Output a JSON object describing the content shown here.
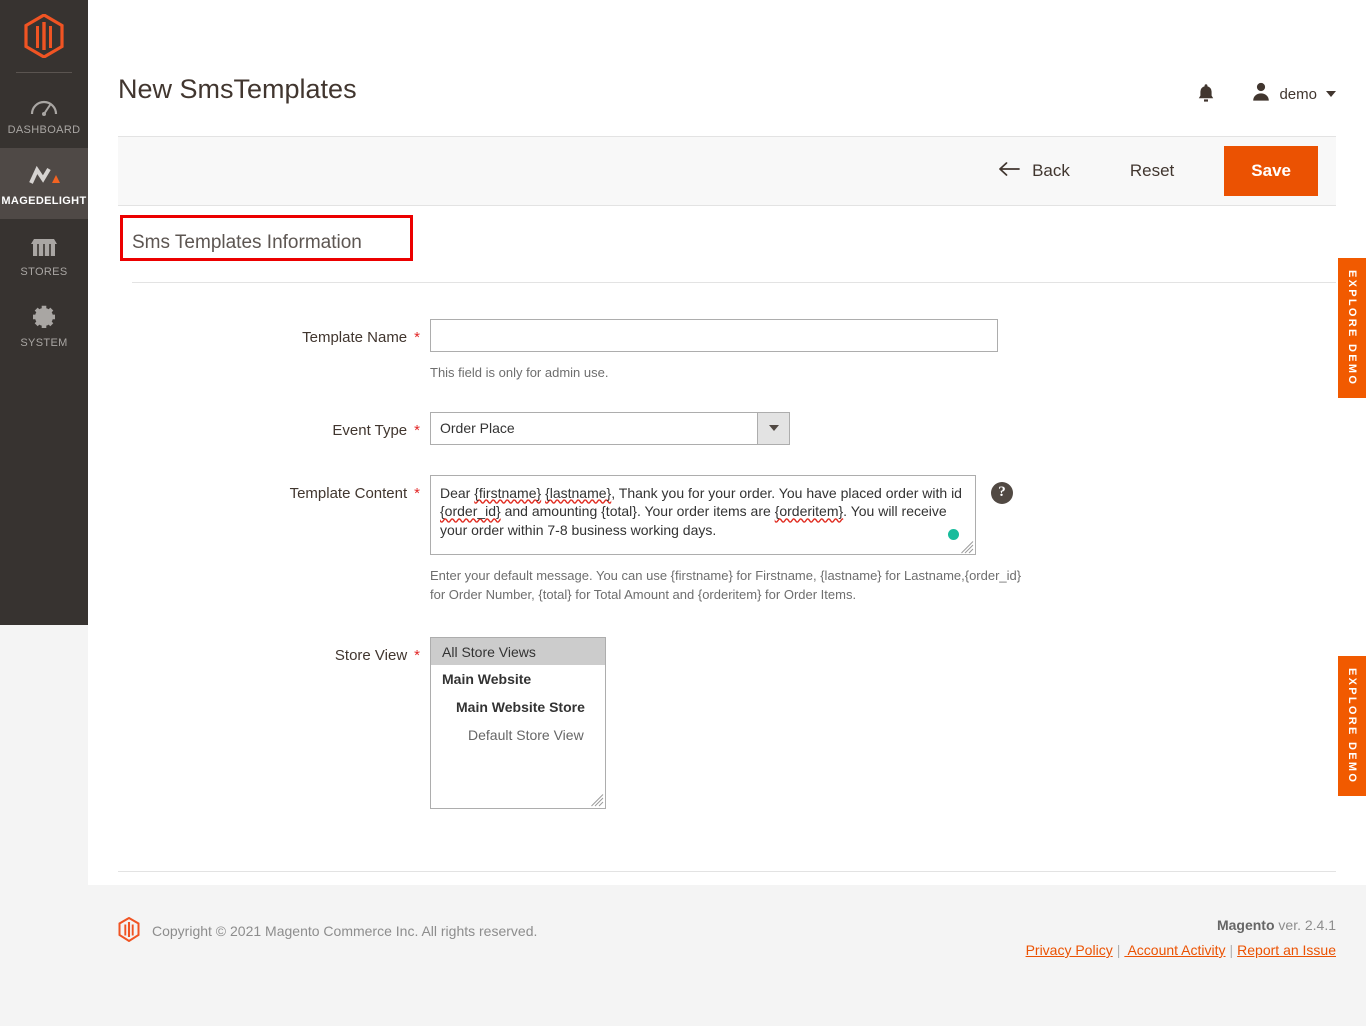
{
  "sidebar": {
    "logo_icon": "magento-logo-icon",
    "items": [
      {
        "label": "DASHBOARD",
        "icon": "dashboard-gauge-icon",
        "active": false
      },
      {
        "label": "MAGEDELIGHT",
        "icon": "magedelight-icon",
        "active": true
      },
      {
        "label": "STORES",
        "icon": "store-icon",
        "active": false
      },
      {
        "label": "SYSTEM",
        "icon": "gear-icon",
        "active": false
      }
    ]
  },
  "header": {
    "title": "New SmsTemplates",
    "bell_icon": "notification-bell-icon",
    "user_icon": "user-avatar-icon",
    "user_name": "demo",
    "caret_icon": "chevron-down-icon"
  },
  "toolbar": {
    "back_label": "Back",
    "back_icon": "arrow-left-icon",
    "reset_label": "Reset",
    "save_label": "Save",
    "save_color": "#eb5202"
  },
  "section": {
    "title": "Sms Templates Information",
    "highlight_color": "#ec0000"
  },
  "form": {
    "template_name": {
      "label": "Template Name",
      "required_mark": "*",
      "value": "",
      "placeholder": "",
      "note": "This field is only for admin use."
    },
    "event_type": {
      "label": "Event Type",
      "required_mark": "*",
      "selected": "Order Place",
      "options": [
        "Order Place"
      ],
      "arrow_icon": "chevron-down-icon"
    },
    "template_content": {
      "label": "Template Content",
      "required_mark": "*",
      "value": "Dear {firstname} {lastname}, Thank you for your order. You have placed order with id {order_id} and amounting {total}. Your order items are {orderitem}. You will receive your order within 7-8 business working days.",
      "segments": [
        {
          "text": "Dear ",
          "misspelled": false
        },
        {
          "text": "{firstname}",
          "misspelled": true
        },
        {
          "text": " ",
          "misspelled": false
        },
        {
          "text": "{lastname}",
          "misspelled": true
        },
        {
          "text": ", Thank you for your order. You have placed order with id ",
          "misspelled": false
        },
        {
          "text": "{order_id}",
          "misspelled": true
        },
        {
          "text": " and amounting {total}. Your order items are ",
          "misspelled": false
        },
        {
          "text": "{orderitem}",
          "misspelled": true
        },
        {
          "text": ". You will receive your order within 7-8 business working days.",
          "misspelled": false
        }
      ],
      "help_icon": "help-question-icon",
      "status_dot_color": "#18bc9c",
      "note": "Enter your default message. You can use {firstname} for Firstname, {lastname} for Lastname,{order_id} for Order Number, {total} for Total Amount and {orderitem} for Order Items."
    },
    "store_view": {
      "label": "Store View",
      "required_mark": "*",
      "options": [
        {
          "label": "All Store Views",
          "level": 0,
          "selected": true
        },
        {
          "label": "Main Website",
          "level": 1,
          "selected": false
        },
        {
          "label": "Main Website Store",
          "level": 2,
          "selected": false
        },
        {
          "label": "Default Store View",
          "level": 3,
          "selected": false
        }
      ]
    }
  },
  "footer": {
    "logo_icon": "magento-footer-logo-icon",
    "copyright": "Copyright © 2021 Magento Commerce Inc. All rights reserved.",
    "brand": "Magento",
    "version": " ver. 2.4.1",
    "links": [
      {
        "label": "Privacy Policy"
      },
      {
        "label": " Account Activity"
      },
      {
        "label": "Report an Issue"
      }
    ],
    "separator": "|"
  },
  "explore_tabs": [
    {
      "label": "EXPLORE DEMO"
    },
    {
      "label": "EXPLORE DEMO"
    }
  ]
}
